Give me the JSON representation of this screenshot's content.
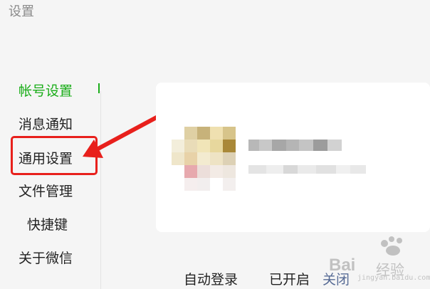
{
  "window": {
    "title": "设置"
  },
  "sidebar": {
    "items": [
      {
        "label": "帐号设置",
        "active": true
      },
      {
        "label": "消息通知"
      },
      {
        "label": "通用设置",
        "highlighted": true
      },
      {
        "label": "文件管理"
      },
      {
        "label": "快捷键"
      },
      {
        "label": "关于微信"
      }
    ]
  },
  "settings": {
    "auto_login_label": "自动登录",
    "auto_login_status": "已开启",
    "auto_login_action": "关闭"
  },
  "watermark": {
    "logo_text": "Bai",
    "logo_sub": "经验",
    "url": "jingyan.baidu.com"
  },
  "colors": {
    "accent": "#1aad19",
    "annotation": "#e8201c",
    "link": "#576b95"
  }
}
